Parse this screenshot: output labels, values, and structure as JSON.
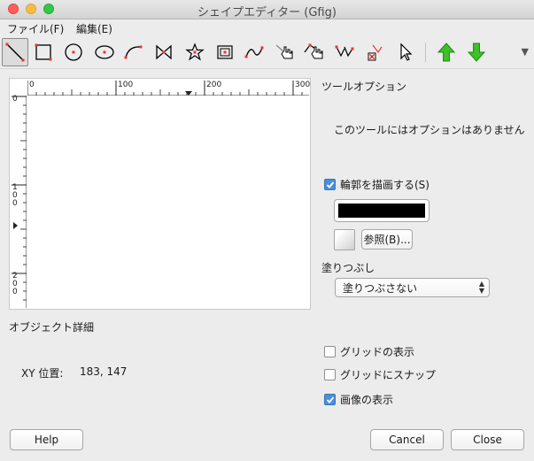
{
  "window": {
    "title": "シェイプエディター (Gfig)"
  },
  "menu": {
    "file": "ファイル(F)",
    "edit": "編集(E)"
  },
  "toolbar": {
    "icons": [
      "line-tool-icon",
      "rectangle-tool-icon",
      "circle-tool-icon",
      "ellipse-tool-icon",
      "arc-tool-icon",
      "polygon-tool-icon",
      "star-tool-icon",
      "spiral-tool-icon",
      "bezier-tool-icon",
      "move-object-icon",
      "move-point-icon",
      "copy-object-icon",
      "delete-object-icon",
      "select-object-icon",
      "raise-object-icon",
      "lower-object-icon"
    ],
    "colors": {
      "up_arrow": "#3fbf2a",
      "down_arrow": "#3fbf2a",
      "active_tool": "#dcdcdc"
    }
  },
  "ruler": {
    "h_labels": [
      "0",
      "100",
      "200",
      "300"
    ],
    "v_labels": [
      "0",
      "1\n0\n0",
      "2\n0\n0"
    ]
  },
  "tool_options": {
    "title": "ツールオプション",
    "message": "このツールにはオプションはありません"
  },
  "stroke": {
    "label": "輪郭を描画する(S)",
    "checked": true,
    "color": "#000000",
    "browse_label": "参照(B)..."
  },
  "fill": {
    "label": "塗りつぶし",
    "selected": "塗りつぶさない"
  },
  "object_details": {
    "label": "オブジェクト詳細",
    "xy_label": "XY 位置:",
    "xy_value": "183, 147"
  },
  "options": {
    "show_grid": {
      "label": "グリッドの表示",
      "checked": false
    },
    "snap_grid": {
      "label": "グリッドにスナップ",
      "checked": false
    },
    "show_image": {
      "label": "画像の表示",
      "checked": true
    }
  },
  "buttons": {
    "help": "Help",
    "cancel": "Cancel",
    "close": "Close"
  }
}
